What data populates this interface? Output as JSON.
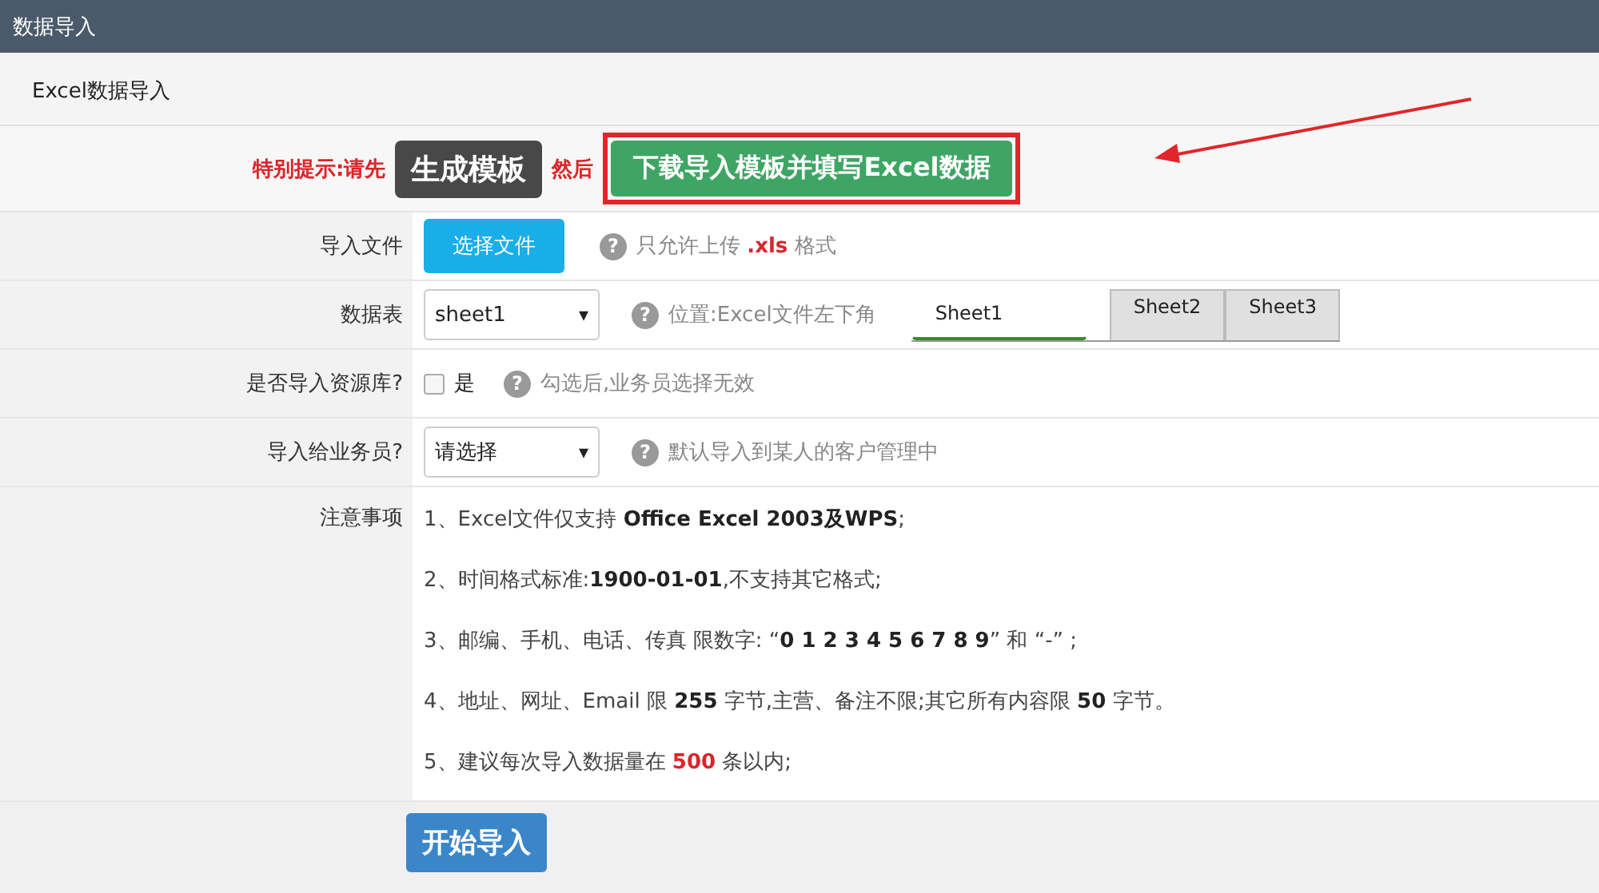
{
  "window": {
    "title": "数据导入"
  },
  "section_title": "Excel数据导入",
  "tip": {
    "prefix": "特别提示:请先",
    "generate_button": "生成模板",
    "middle": "然后",
    "download_button": "下载导入模板并填写Excel数据"
  },
  "rows": [
    {
      "kind": "file",
      "label": "导入文件",
      "button": "选择文件",
      "help_icon": "?",
      "hint": [
        {
          "t": "只允许上传 ",
          "kind": "plain"
        },
        {
          "t": ".xls",
          "kind": "red"
        },
        {
          "t": " 格式",
          "kind": "plain"
        }
      ]
    },
    {
      "kind": "select",
      "label": "数据表",
      "value": "sheet1",
      "caret": "▾",
      "help_icon": "?",
      "hint": [
        {
          "t": "位置:Excel文件左下角",
          "kind": "plain"
        }
      ],
      "sheet_tabs": [
        {
          "label": "Sheet1",
          "selected": true
        },
        {
          "label": "Sheet2",
          "selected": false
        },
        {
          "label": "Sheet3",
          "selected": false
        }
      ]
    },
    {
      "kind": "checkbox",
      "label": "是否导入资源库?",
      "checked": false,
      "option": "是",
      "help_icon": "?",
      "hint": [
        {
          "t": "勾选后,业务员选择无效",
          "kind": "plain"
        }
      ]
    },
    {
      "kind": "select",
      "label": "导入给业务员?",
      "value": "请选择",
      "caret": "▾",
      "help_icon": "?",
      "hint": [
        {
          "t": "默认导入到某人的客户管理中",
          "kind": "plain"
        }
      ]
    },
    {
      "kind": "notes",
      "label": "注意事项",
      "notes": [
        [
          {
            "t": "1、Excel文件仅支持 ",
            "kind": "plain"
          },
          {
            "t": "Office Excel 2003及WPS",
            "kind": "bold"
          },
          {
            "t": ";",
            "kind": "plain"
          }
        ],
        [
          {
            "t": "2、时间格式标准:",
            "kind": "plain"
          },
          {
            "t": "1900-01-01",
            "kind": "bold"
          },
          {
            "t": ",不支持其它格式;",
            "kind": "plain"
          }
        ],
        [
          {
            "t": "3、邮编、手机、电话、传真 限数字: “",
            "kind": "plain"
          },
          {
            "t": "0 1 2 3 4 5 6 7 8 9",
            "kind": "bold"
          },
          {
            "t": "” 和 “-” ;",
            "kind": "plain"
          }
        ],
        [
          {
            "t": "4、地址、网址、Email 限 ",
            "kind": "plain"
          },
          {
            "t": "255",
            "kind": "bold"
          },
          {
            "t": " 字节,主营、备注不限;其它所有内容限 ",
            "kind": "plain"
          },
          {
            "t": "50",
            "kind": "bold"
          },
          {
            "t": " 字节。",
            "kind": "plain"
          }
        ],
        [
          {
            "t": "5、建议每次导入数据量在 ",
            "kind": "plain"
          },
          {
            "t": "500",
            "kind": "red"
          },
          {
            "t": " 条以内;",
            "kind": "plain"
          }
        ]
      ]
    }
  ],
  "start_button": "开始导入"
}
